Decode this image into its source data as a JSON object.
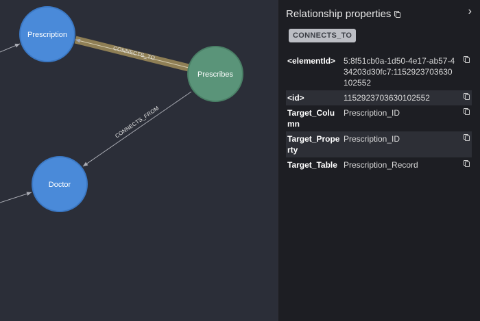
{
  "graph": {
    "nodes": {
      "prescription": "Prescription",
      "prescribes": "Prescribes",
      "doctor": "Doctor"
    },
    "relationships": {
      "connects_to": "CONNECTS_TO",
      "connects_from": "CONNECTS_FROM"
    },
    "colors": {
      "node_blue": "#4a8ad9",
      "node_green": "#5a9479",
      "highlight": "#8f7f55",
      "edge": "#a9abb3"
    }
  },
  "panel": {
    "title": "Relationship properties",
    "relationship_type": "CONNECTS_TO",
    "properties": [
      {
        "key": "<elementId>",
        "value": "5:8f51cb0a-1d50-4e17-ab57-434203d30fc7:1152923703630102552"
      },
      {
        "key": "<id>",
        "value": "1152923703630102552"
      },
      {
        "key": "Target_Column",
        "value": "Prescription_ID"
      },
      {
        "key": "Target_Property",
        "value": "Prescription_ID"
      },
      {
        "key": "Target_Table",
        "value": "Prescription_Record"
      }
    ]
  }
}
